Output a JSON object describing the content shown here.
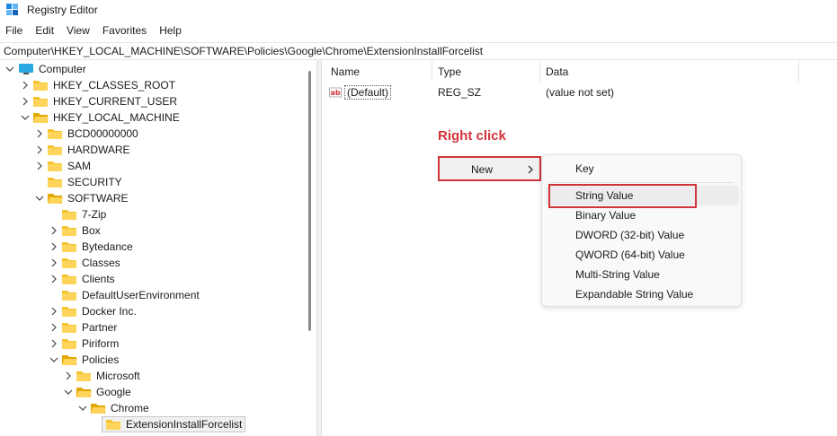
{
  "window": {
    "title": "Registry Editor"
  },
  "menu": [
    "File",
    "Edit",
    "View",
    "Favorites",
    "Help"
  ],
  "address": "Computer\\HKEY_LOCAL_MACHINE\\SOFTWARE\\Policies\\Google\\Chrome\\ExtensionInstallForcelist",
  "tree": {
    "root": "Computer",
    "hives": [
      "HKEY_CLASSES_ROOT",
      "HKEY_CURRENT_USER",
      "HKEY_LOCAL_MACHINE"
    ],
    "hklm_children": [
      "BCD00000000",
      "HARDWARE",
      "SAM",
      "SECURITY",
      "SOFTWARE"
    ],
    "software_children": [
      "7-Zip",
      "Box",
      "Bytedance",
      "Classes",
      "Clients",
      "DefaultUserEnvironment",
      "Docker Inc.",
      "Partner",
      "Piriform",
      "Policies"
    ],
    "policies_children": [
      "Microsoft",
      "Google"
    ],
    "google_children": [
      "Chrome"
    ],
    "chrome_children": [
      "ExtensionInstallForcelist"
    ]
  },
  "list": {
    "columns": [
      "Name",
      "Type",
      "Data"
    ],
    "rows": [
      {
        "name": "(Default)",
        "type": "REG_SZ",
        "data": "(value not set)"
      }
    ]
  },
  "annotation": "Right click",
  "context_menu": {
    "new_label": "New",
    "submenu": [
      "Key",
      "String Value",
      "Binary Value",
      "DWORD (32-bit) Value",
      "QWORD (64-bit) Value",
      "Multi-String Value",
      "Expandable String Value"
    ]
  },
  "colors": {
    "highlight_red": "#d13438",
    "folder": "#f4c430",
    "selected_bg": "#f0f0f0"
  }
}
